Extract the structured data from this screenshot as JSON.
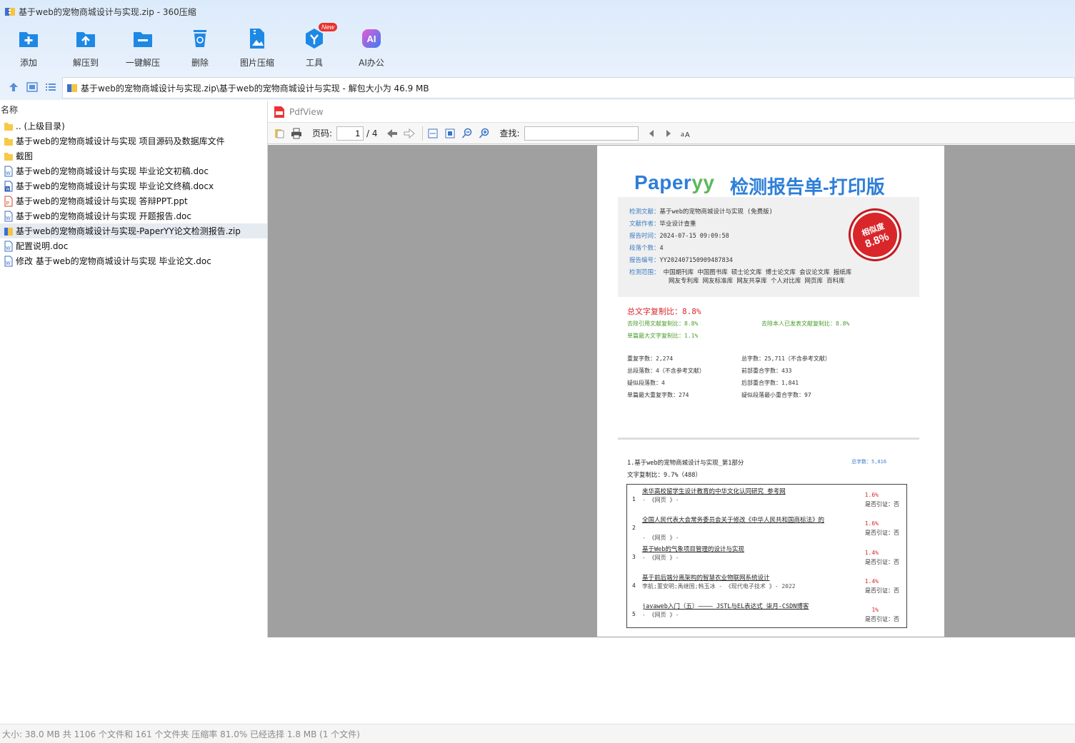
{
  "window": {
    "title": "基于web的宠物商城设计与实现.zip - 360压缩"
  },
  "toolbar": {
    "items": [
      {
        "label": "添加",
        "icon": "add-icon"
      },
      {
        "label": "解压到",
        "icon": "extract-to-icon"
      },
      {
        "label": "一键解压",
        "icon": "one-click-extract-icon"
      },
      {
        "label": "删除",
        "icon": "delete-icon"
      },
      {
        "label": "图片压缩",
        "icon": "image-compress-icon"
      },
      {
        "label": "工具",
        "icon": "tools-icon",
        "badge": "New"
      },
      {
        "label": "AI办公",
        "icon": "ai-office-icon"
      }
    ]
  },
  "address": {
    "path": "基于web的宠物商城设计与实现.zip\\基于web的宠物商城设计与实现 - 解包大小为 46.9 MB"
  },
  "filelist": {
    "header": "名称",
    "rows": [
      {
        "name": ".. (上级目录)",
        "type": "folder"
      },
      {
        "name": "基于web的宠物商城设计与实现 项目源码及数据库文件",
        "type": "folder"
      },
      {
        "name": "截图",
        "type": "folder"
      },
      {
        "name": "基于web的宠物商城设计与实现 毕业论文初稿.doc",
        "type": "doc"
      },
      {
        "name": "基于web的宠物商城设计与实现 毕业论文终稿.docx",
        "type": "docx"
      },
      {
        "name": "基于web的宠物商城设计与实现 答辩PPT.ppt",
        "type": "ppt"
      },
      {
        "name": "基于web的宠物商城设计与实现 开题报告.doc",
        "type": "doc"
      },
      {
        "name": "基于web的宠物商城设计与实现-PaperYY论文检测报告.zip",
        "type": "zip",
        "selected": true
      },
      {
        "name": "配置说明.doc",
        "type": "doc"
      },
      {
        "name": "修改  基于web的宠物商城设计与实现 毕业论文.doc",
        "type": "doc"
      }
    ]
  },
  "pdfview": {
    "title": "PdfView",
    "page_label": "页码:",
    "page_current": "1",
    "page_total": "/ 4",
    "find_label": "查找:",
    "find_value": ""
  },
  "report": {
    "logo_text": "Paper",
    "logo_yy": "yy",
    "title": "检测报告单-打印版",
    "info": [
      {
        "k": "检测文献：",
        "v": "基于web的宠物商城设计与实现 (免费版)"
      },
      {
        "k": "文献作者：",
        "v": "毕业设计查重"
      },
      {
        "k": "报告时间：",
        "v": "2024-07-15 09:09:58"
      },
      {
        "k": "段落个数：",
        "v": "4"
      },
      {
        "k": "报告编号：",
        "v": "YY202407150909487834"
      },
      {
        "k": "检测范围：",
        "v": "中国期刊库 中国图书库 硕士论文库 博士论文库 会议论文库 报纸库",
        "v2": "网友专利库 网友标准库 网友共享库 个人对比库 网页库 百科库"
      }
    ],
    "stamp_line1": "相似度",
    "stamp_line2": "8.8%",
    "total_copy": "总文字复制比：8.8%",
    "exclude_ref": "去除引用文献复制比：8.8%",
    "exclude_self": "去除本人已发表文献复制比：8.8%",
    "single_max": "单篇最大文字复制比：1.1%",
    "stats_left": [
      "重复字数：2,274",
      "总段落数：4（不含参考文献）",
      "疑似段落数：4",
      "单篇最大重复字数：274"
    ],
    "stats_right": [
      "总字数：25,711（不含参考文献）",
      "前部重合字数：433",
      "后部重合字数：1,841",
      "疑似段落最小重合字数：97"
    ],
    "section_title": "1.基于web的宠物商城设计与实现_第1部分",
    "section_total": "总字数：5,016",
    "section_copy": "文字复制比：9.7%（488）",
    "similar": [
      {
        "no": "1",
        "title": "来华高校留学生设计教育的中华文化认同研究_参考网",
        "source": "- 《网页 》-",
        "pct": "1.6%",
        "cite": "是否引证：否"
      },
      {
        "no": "2",
        "title": "全国人民代表大会常务委员会关于修改《中华人民共和国商标法》的",
        "source": "- 《网页 》-",
        "pct": "1.6%",
        "cite": "是否引证：否"
      },
      {
        "no": "3",
        "title": "基于Web的气象项目管理的设计与实现",
        "source": "- 《网页 》-",
        "pct": "1.4%",
        "cite": "是否引证：否"
      },
      {
        "no": "4",
        "title": "基于前后端分离架构的智慧农业物联网系统设计",
        "source": "李航;董安明;禹继国;韩玉冰 - 《现代电子技术 》- 2022",
        "pct": "1.4%",
        "cite": "是否引证：否"
      },
      {
        "no": "5",
        "title": "javaweb入门（五）———— JSTL与EL表达式_柒月-CSDN博客",
        "source": "- 《网页 》-",
        "pct": "1%",
        "cite": "是否引证：否"
      }
    ]
  },
  "status": {
    "text": "大小: 38.0 MB 共 1106 个文件和 161 个文件夹 压缩率 81.0% 已经选择 1.8 MB (1 个文件)"
  },
  "colors": {
    "accent": "#2e7fd8",
    "stamp_red": "#d9262a",
    "green": "#4a9c2a",
    "viewer_bg": "#a0a0a0"
  }
}
